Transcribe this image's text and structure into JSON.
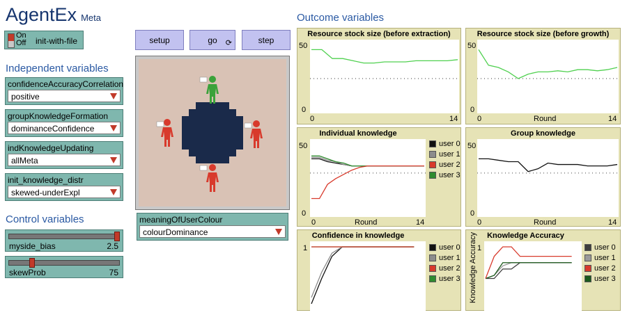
{
  "app": {
    "title": "AgentEx",
    "subtitle": "Meta"
  },
  "switch": {
    "on": "On",
    "off": "Off",
    "label": "init-with-file"
  },
  "sections": {
    "independent": "Independent variables",
    "control": "Control variables",
    "outcome": "Outcome variables"
  },
  "choosers": [
    {
      "label": "confidenceAccuracyCorrelation",
      "value": "positive"
    },
    {
      "label": "groupKnowledgeFormation",
      "value": "dominanceConfidence"
    },
    {
      "label": "indKnowledgeUpdating",
      "value": "allMeta"
    },
    {
      "label": "init_knowledge_distr",
      "value": "skewed-underExpl"
    }
  ],
  "sliders": [
    {
      "label": "myside_bias",
      "value": "2.5",
      "level": 1.0
    },
    {
      "label": "skewProb",
      "value": "75",
      "level": 0.2
    }
  ],
  "buttons": {
    "setup": "setup",
    "go": "go",
    "step": "step"
  },
  "colourChooser": {
    "label": "meaningOfUserColour",
    "value": "colourDominance"
  },
  "plots": {
    "resource_extraction": {
      "title": "Resource stock size (before extraction)",
      "ymax": "50",
      "ymin": "0",
      "xmin": "0",
      "xmax": "14",
      "xlabel": ""
    },
    "resource_growth": {
      "title": "Resource stock size (before growth)",
      "ymax": "50",
      "ymin": "0",
      "xmin": "0",
      "xmax": "14",
      "xlabel": "Round"
    },
    "individual": {
      "title": "Individual knowledge",
      "ymax": "50",
      "ymin": "0",
      "xmin": "0",
      "xmax": "14",
      "xlabel": "Round"
    },
    "group": {
      "title": "Group knowledge",
      "ymax": "50",
      "ymin": "0",
      "xmin": "0",
      "xmax": "14",
      "xlabel": "Round"
    },
    "confidence": {
      "title": "Confidence in knowledge",
      "ymax": "1"
    },
    "accuracy": {
      "title": "Knowledge Accuracy",
      "ymax": "1",
      "ylabel": "Knowledge Accuracy"
    }
  },
  "legend": [
    "user 0",
    "user 1",
    "user 2",
    "user 3"
  ],
  "colors": {
    "user0": "#111111",
    "user1": "#8c8c8c",
    "user2": "#d83a2c",
    "user3": "#2f8b2f",
    "acc_user0": "#3e3e3e",
    "acc_user1": "#9a9a9a",
    "acc_user2": "#d83a2c",
    "acc_user3": "#1c5a1c",
    "resource": "#4fd04f",
    "group": "#111111"
  },
  "chart_data": [
    {
      "type": "line",
      "title": "Resource stock size (before extraction)",
      "xlim": [
        0,
        14
      ],
      "ylim": [
        0,
        60
      ],
      "series": [
        {
          "x": [
            0,
            1,
            2,
            3,
            4,
            5,
            6,
            7,
            8,
            9,
            10,
            11,
            12,
            13,
            14
          ],
          "values": [
            56,
            56,
            48,
            48,
            46,
            44,
            44,
            45,
            45,
            45,
            46,
            46,
            46,
            46,
            47
          ]
        }
      ],
      "reference_line": 30
    },
    {
      "type": "line",
      "title": "Resource stock size (before growth)",
      "xlabel": "Round",
      "xlim": [
        0,
        14
      ],
      "ylim": [
        0,
        60
      ],
      "series": [
        {
          "x": [
            0,
            1,
            2,
            3,
            4,
            5,
            6,
            7,
            8,
            9,
            10,
            11,
            12,
            13,
            14
          ],
          "values": [
            56,
            42,
            40,
            36,
            30,
            34,
            36,
            36,
            37,
            36,
            38,
            38,
            37,
            38,
            40
          ]
        }
      ],
      "reference_line": 30
    },
    {
      "type": "line",
      "title": "Individual knowledge",
      "xlabel": "Round",
      "xlim": [
        0,
        14
      ],
      "ylim": [
        0,
        50
      ],
      "series": [
        {
          "name": "user 0",
          "x": [
            0,
            1,
            2,
            3,
            4,
            5,
            6,
            7,
            8,
            9,
            10,
            11,
            12,
            13,
            14
          ],
          "values": [
            40,
            40,
            38,
            37,
            36,
            35,
            35,
            35,
            35,
            35,
            35,
            35,
            35,
            35,
            35
          ]
        },
        {
          "name": "user 1",
          "x": [
            0,
            1,
            2,
            3,
            4,
            5,
            6,
            7,
            8,
            9,
            10,
            11,
            12,
            13,
            14
          ],
          "values": [
            41,
            41,
            39,
            38,
            36,
            35,
            35,
            35,
            35,
            35,
            35,
            35,
            35,
            35,
            35
          ]
        },
        {
          "name": "user 2",
          "x": [
            0,
            1,
            2,
            3,
            4,
            5,
            6,
            7,
            8,
            9,
            10,
            11,
            12,
            13,
            14
          ],
          "values": [
            12,
            12,
            22,
            26,
            29,
            32,
            34,
            35,
            35,
            35,
            35,
            35,
            35,
            35,
            35
          ]
        },
        {
          "name": "user 3",
          "x": [
            0,
            1,
            2,
            3,
            4,
            5,
            6,
            7,
            8,
            9,
            10,
            11,
            12,
            13,
            14
          ],
          "values": [
            42,
            42,
            40,
            38,
            37,
            35,
            35,
            35,
            35,
            35,
            35,
            35,
            35,
            35,
            35
          ]
        }
      ],
      "reference_line": 30
    },
    {
      "type": "line",
      "title": "Group knowledge",
      "xlabel": "Round",
      "xlim": [
        0,
        14
      ],
      "ylim": [
        0,
        50
      ],
      "series": [
        {
          "x": [
            0,
            1,
            2,
            3,
            4,
            5,
            6,
            7,
            8,
            9,
            10,
            11,
            12,
            13,
            14
          ],
          "values": [
            40,
            40,
            39,
            38,
            38,
            31,
            33,
            37,
            36,
            36,
            36,
            35,
            35,
            35,
            36
          ]
        }
      ],
      "reference_line": 30
    },
    {
      "type": "line",
      "title": "Confidence in knowledge",
      "ylim": [
        0,
        1
      ],
      "series": [
        {
          "name": "user 0",
          "x": [
            0,
            1,
            2,
            3,
            4,
            5,
            6,
            7,
            8,
            9,
            10
          ],
          "values": [
            0.1,
            0.5,
            0.85,
            1,
            1,
            1,
            1,
            1,
            1,
            1,
            1
          ]
        },
        {
          "name": "user 1",
          "x": [
            0,
            1,
            2,
            3,
            4,
            5,
            6,
            7,
            8,
            9,
            10
          ],
          "values": [
            0.2,
            0.6,
            0.9,
            1,
            1,
            1,
            1,
            1,
            1,
            1,
            1
          ]
        },
        {
          "name": "user 2",
          "x": [
            0,
            1,
            2,
            3,
            4,
            5,
            6,
            7,
            8,
            9,
            10
          ],
          "values": [
            1,
            1,
            1,
            1,
            1,
            1,
            1,
            1,
            1,
            1,
            1
          ]
        },
        {
          "name": "user 3",
          "x": [
            0,
            1,
            2,
            3,
            4,
            5,
            6,
            7,
            8,
            9,
            10
          ],
          "values": [
            1,
            1,
            1,
            1,
            1,
            1,
            1,
            1,
            1,
            1,
            1
          ]
        }
      ]
    },
    {
      "type": "line",
      "title": "Knowledge Accuracy",
      "ylabel": "Knowledge Accuracy",
      "ylim": [
        0,
        1
      ],
      "series": [
        {
          "name": "user 0",
          "x": [
            0,
            1,
            2,
            3,
            4,
            5,
            6,
            7,
            8,
            9,
            10
          ],
          "values": [
            0.5,
            0.5,
            0.65,
            0.65,
            0.75,
            0.75,
            0.75,
            0.75,
            0.75,
            0.75,
            0.75
          ]
        },
        {
          "name": "user 1",
          "x": [
            0,
            1,
            2,
            3,
            4,
            5,
            6,
            7,
            8,
            9,
            10
          ],
          "values": [
            0.5,
            0.55,
            0.7,
            0.75,
            0.75,
            0.75,
            0.75,
            0.75,
            0.75,
            0.75,
            0.75
          ]
        },
        {
          "name": "user 2",
          "x": [
            0,
            1,
            2,
            3,
            4,
            5,
            6,
            7,
            8,
            9,
            10
          ],
          "values": [
            0.5,
            0.85,
            1,
            1,
            0.85,
            0.85,
            0.85,
            0.85,
            0.85,
            0.85,
            0.85
          ]
        },
        {
          "name": "user 3",
          "x": [
            0,
            1,
            2,
            3,
            4,
            5,
            6,
            7,
            8,
            9,
            10
          ],
          "values": [
            0.5,
            0.55,
            0.75,
            0.75,
            0.75,
            0.75,
            0.75,
            0.75,
            0.75,
            0.75,
            0.75
          ]
        }
      ]
    }
  ]
}
